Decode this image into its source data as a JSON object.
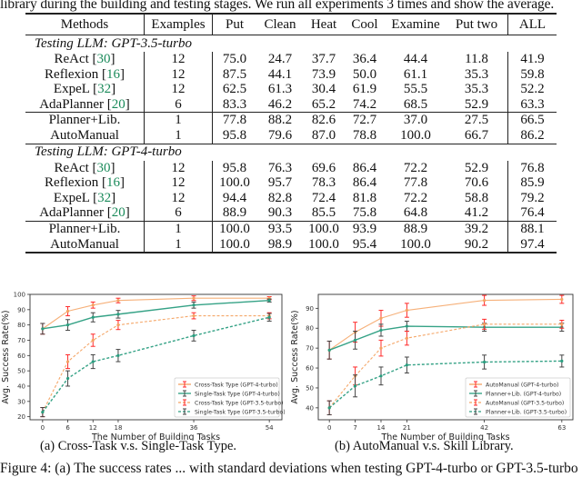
{
  "caption_top": "library during the building and testing stages. We run all experiments 3 times and show the average.",
  "table": {
    "headers": [
      "Methods",
      "Examples",
      "Put",
      "Clean",
      "Heat",
      "Cool",
      "Examine",
      "Put two",
      "ALL"
    ],
    "sections": [
      {
        "label": "Testing LLM: GPT-3.5-turbo",
        "groups": [
          [
            {
              "method": "ReAct",
              "ref": "30",
              "examples": "12",
              "values": [
                "75.0",
                "24.7",
                "37.7",
                "36.4",
                "44.4",
                "11.8",
                "41.9"
              ],
              "bold": []
            },
            {
              "method": "Reflexion",
              "ref": "16",
              "examples": "12",
              "values": [
                "87.5",
                "44.1",
                "73.9",
                "50.0",
                "61.1",
                "35.3",
                "59.8"
              ],
              "bold": []
            },
            {
              "method": "ExpeL",
              "ref": "32",
              "examples": "12",
              "values": [
                "62.5",
                "61.3",
                "30.4",
                "61.9",
                "55.5",
                "35.3",
                "52.2"
              ],
              "bold": []
            },
            {
              "method": "AdaPlanner",
              "ref": "20",
              "examples": "6",
              "values": [
                "83.3",
                "46.2",
                "65.2",
                "74.2",
                "68.5",
                "52.9",
                "63.3"
              ],
              "bold": []
            }
          ],
          [
            {
              "method": "Planner+Lib.",
              "ref": "",
              "examples": "1",
              "values": [
                "77.8",
                "88.2",
                "82.6",
                "72.7",
                "37.0",
                "27.5",
                "66.5"
              ],
              "bold": [
                1
              ]
            },
            {
              "method": "AutoManual",
              "ref": "",
              "examples": "1",
              "values": [
                "95.8",
                "79.6",
                "87.0",
                "78.8",
                "100.0",
                "66.7",
                "86.2"
              ],
              "bold": [
                0,
                2,
                3,
                4,
                5,
                6
              ]
            }
          ]
        ]
      },
      {
        "label": "Testing LLM: GPT-4-turbo",
        "groups": [
          [
            {
              "method": "ReAct",
              "ref": "30",
              "examples": "12",
              "values": [
                "95.8",
                "76.3",
                "69.6",
                "86.4",
                "72.2",
                "52.9",
                "76.8"
              ],
              "bold": []
            },
            {
              "method": "Reflexion",
              "ref": "16",
              "examples": "12",
              "values": [
                "100.0",
                "95.7",
                "78.3",
                "86.4",
                "77.8",
                "70.6",
                "85.9"
              ],
              "bold": [
                0
              ]
            },
            {
              "method": "ExpeL",
              "ref": "32",
              "examples": "12",
              "values": [
                "94.4",
                "82.8",
                "72.4",
                "81.8",
                "72.2",
                "58.8",
                "79.2"
              ],
              "bold": []
            },
            {
              "method": "AdaPlanner",
              "ref": "20",
              "examples": "6",
              "values": [
                "88.9",
                "90.3",
                "85.5",
                "75.8",
                "64.8",
                "41.2",
                "76.4"
              ],
              "bold": []
            }
          ],
          [
            {
              "method": "Planner+Lib.",
              "ref": "",
              "examples": "1",
              "values": [
                "100.0",
                "93.5",
                "100.0",
                "93.9",
                "88.9",
                "39.2",
                "88.1"
              ],
              "bold": [
                0,
                2
              ]
            },
            {
              "method": "AutoManual",
              "ref": "",
              "examples": "1",
              "values": [
                "100.0",
                "98.9",
                "100.0",
                "95.4",
                "100.0",
                "90.2",
                "97.4"
              ],
              "bold": [
                0,
                1,
                2,
                3,
                4,
                5,
                6
              ]
            }
          ]
        ]
      }
    ]
  },
  "colors": {
    "orange": "#f4a261",
    "teal": "#2a9d7f",
    "err_red": "#ff2a2a",
    "err_dark": "#444444",
    "ref_green": "#1a8a5a"
  },
  "chart_data": [
    {
      "type": "line",
      "title": "",
      "xlabel": "The Number of Building Tasks",
      "ylabel": "Avg. Success Rate(%)",
      "x": [
        0,
        6,
        12,
        18,
        36,
        54
      ],
      "xticks": [
        "0",
        "6",
        "12",
        "18",
        "36",
        "54"
      ],
      "yticks": [
        "20",
        "30",
        "40",
        "50",
        "60",
        "70",
        "80",
        "90",
        "100"
      ],
      "ylim": [
        18,
        100
      ],
      "xlim": [
        -3,
        57
      ],
      "grid": false,
      "legend_position": "bottom-right",
      "series": [
        {
          "name": "Cross-Task Type (GPT-4-turbo)",
          "style": "solid",
          "color": "orange",
          "err_color": "err_red",
          "values": [
            77.5,
            89,
            93,
            96,
            97.5,
            97.5
          ],
          "errors": [
            3.5,
            3,
            2,
            1.5,
            1.5,
            1
          ]
        },
        {
          "name": "Single-Task Type (GPT-4-turbo)",
          "style": "solid",
          "color": "teal",
          "err_color": "err_dark",
          "values": [
            77.5,
            80,
            85,
            87,
            93,
            96
          ],
          "errors": [
            3.5,
            3.5,
            3,
            2.5,
            2,
            1
          ]
        },
        {
          "name": "Cross-Task Type (GPT-3.5-turbo)",
          "style": "dashed",
          "color": "orange",
          "err_color": "err_red",
          "values": [
            23,
            56,
            70,
            80,
            86,
            86
          ],
          "errors": [
            3,
            4.5,
            4,
            3,
            2,
            2
          ]
        },
        {
          "name": "Single-Task Type (GPT-3.5-turbo)",
          "style": "dashed",
          "color": "teal",
          "err_color": "err_dark",
          "values": [
            23,
            45,
            56,
            60,
            73,
            85
          ],
          "errors": [
            3,
            5,
            4.5,
            4,
            3.5,
            2.5
          ]
        }
      ],
      "subcaption": "(a) Cross-Task v.s. Single-Task Type."
    },
    {
      "type": "line",
      "title": "",
      "xlabel": "The Number of Building Tasks",
      "ylabel": "Avg. Success Rate(%)",
      "x": [
        0,
        7,
        14,
        21,
        42,
        63
      ],
      "xticks": [
        "0",
        "7",
        "14",
        "21",
        "42",
        "63"
      ],
      "yticks": [
        "40",
        "50",
        "60",
        "70",
        "80",
        "90"
      ],
      "ylim": [
        34,
        97
      ],
      "xlim": [
        -3,
        66
      ],
      "grid": false,
      "legend_position": "bottom-right",
      "series": [
        {
          "name": "AutoManual (GPT-4-turbo)",
          "style": "solid",
          "color": "orange",
          "err_color": "err_red",
          "values": [
            69,
            78,
            85,
            89,
            94,
            94.5
          ],
          "errors": [
            4.5,
            5,
            4,
            3.5,
            2.5,
            2
          ]
        },
        {
          "name": "Planner+Lib. (GPT-4-turbo)",
          "style": "solid",
          "color": "teal",
          "err_color": "err_dark",
          "values": [
            69,
            74,
            79,
            81,
            80.5,
            80.5
          ],
          "errors": [
            4.5,
            4.5,
            3,
            2.5,
            2,
            2
          ]
        },
        {
          "name": "AutoManual (GPT-3.5-turbo)",
          "style": "dashed",
          "color": "orange",
          "err_color": "err_red",
          "values": [
            40,
            56,
            70,
            75,
            82,
            82
          ],
          "errors": [
            3.5,
            4.5,
            4,
            3.5,
            2.5,
            2
          ]
        },
        {
          "name": "Planner+Lib. (GPT-3.5-turbo)",
          "style": "dashed",
          "color": "teal",
          "err_color": "err_dark",
          "values": [
            40,
            51,
            56,
            61.5,
            63,
            63.5
          ],
          "errors": [
            3.5,
            5.5,
            4.5,
            4,
            3.5,
            3
          ]
        }
      ],
      "subcaption": "(b) AutoManual v.s. Skill Library."
    }
  ],
  "figure_caption": "Figure 4: (a) The success rates ... with standard deviations when testing GPT-4-turbo or GPT-3.5-turbo"
}
